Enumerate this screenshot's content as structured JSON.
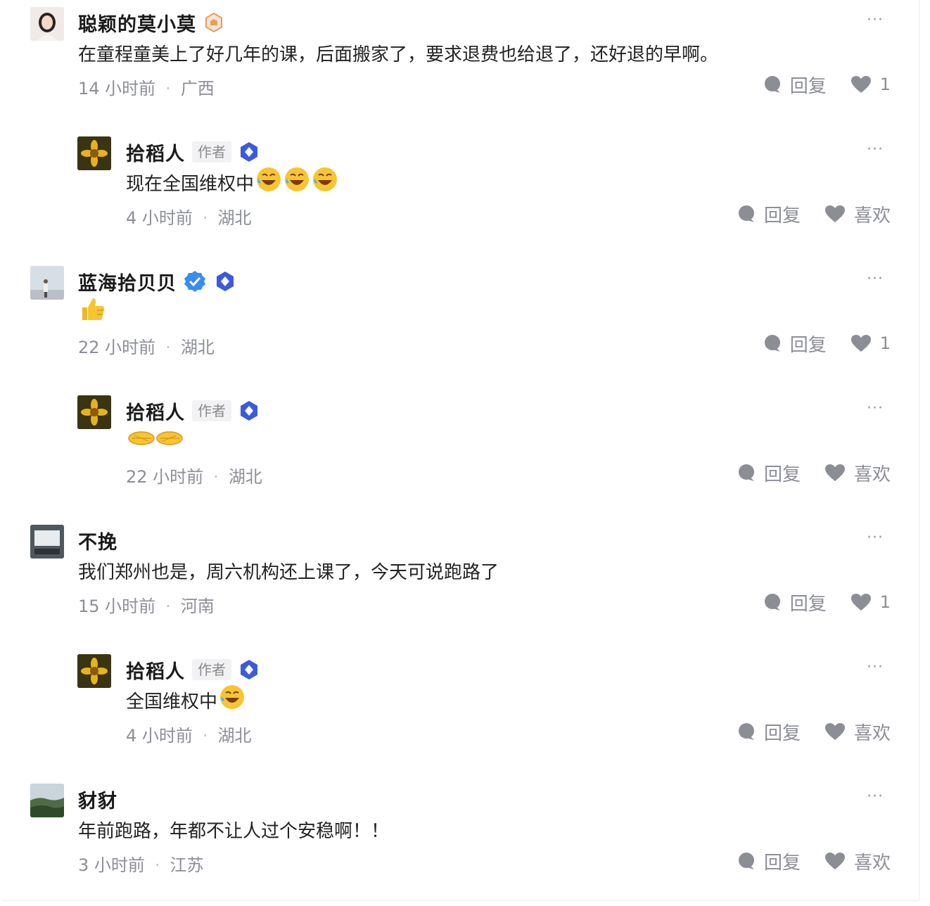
{
  "badge_colors": {
    "verified_blue": "#3a8cf0",
    "hexagon_blue": "#3b5bdb",
    "level_orange": "#e0a060"
  },
  "comments": [
    {
      "avatar_icon": "woman-portrait-avatar",
      "name": "聪颖的莫小莫",
      "text": "在童程童美上了好几年的课，后面搬家了，要求退费也给退了，还好退的早啊。",
      "time": "14 小时前",
      "location": "广西",
      "reply_label": "回复",
      "like_count": "1",
      "more": "···"
    },
    {
      "avatar_icon": "flower-avatar",
      "name": "拾稻人",
      "author_tag": "作者",
      "text": "现在全国维权中",
      "emoji_icons": [
        "laugh-cry-emoji",
        "laugh-cry-emoji",
        "laugh-cry-emoji"
      ],
      "time": "4 小时前",
      "location": "湖北",
      "reply_label": "回复",
      "like_label": "喜欢",
      "more": "···"
    },
    {
      "avatar_icon": "man-outdoor-avatar",
      "name": "蓝海拾贝贝",
      "emoji_icons": [
        "thumbs-up-emoji"
      ],
      "time": "22 小时前",
      "location": "湖北",
      "reply_label": "回复",
      "like_count": "1",
      "more": "···"
    },
    {
      "avatar_icon": "flower-avatar",
      "name": "拾稻人",
      "author_tag": "作者",
      "emoji_icons": [
        "clap-hands-emoji"
      ],
      "time": "22 小时前",
      "location": "湖北",
      "reply_label": "回复",
      "like_label": "喜欢",
      "more": "···"
    },
    {
      "avatar_icon": "screen-avatar",
      "name": "不挽",
      "text": "我们郑州也是，周六机构还上课了，今天可说跑路了",
      "time": "15 小时前",
      "location": "河南",
      "reply_label": "回复",
      "like_count": "1",
      "more": "···"
    },
    {
      "avatar_icon": "flower-avatar",
      "name": "拾稻人",
      "author_tag": "作者",
      "text": "全国维权中",
      "emoji_icons": [
        "laugh-cry-emoji"
      ],
      "time": "4 小时前",
      "location": "湖北",
      "reply_label": "回复",
      "like_label": "喜欢",
      "more": "···"
    },
    {
      "avatar_icon": "forest-landscape-avatar",
      "name": "豺豺",
      "text": "年前跑路，年都不让人过个安稳啊！！",
      "time": "3 小时前",
      "location": "江苏",
      "reply_label": "回复",
      "like_label": "喜欢",
      "more": "···"
    }
  ]
}
